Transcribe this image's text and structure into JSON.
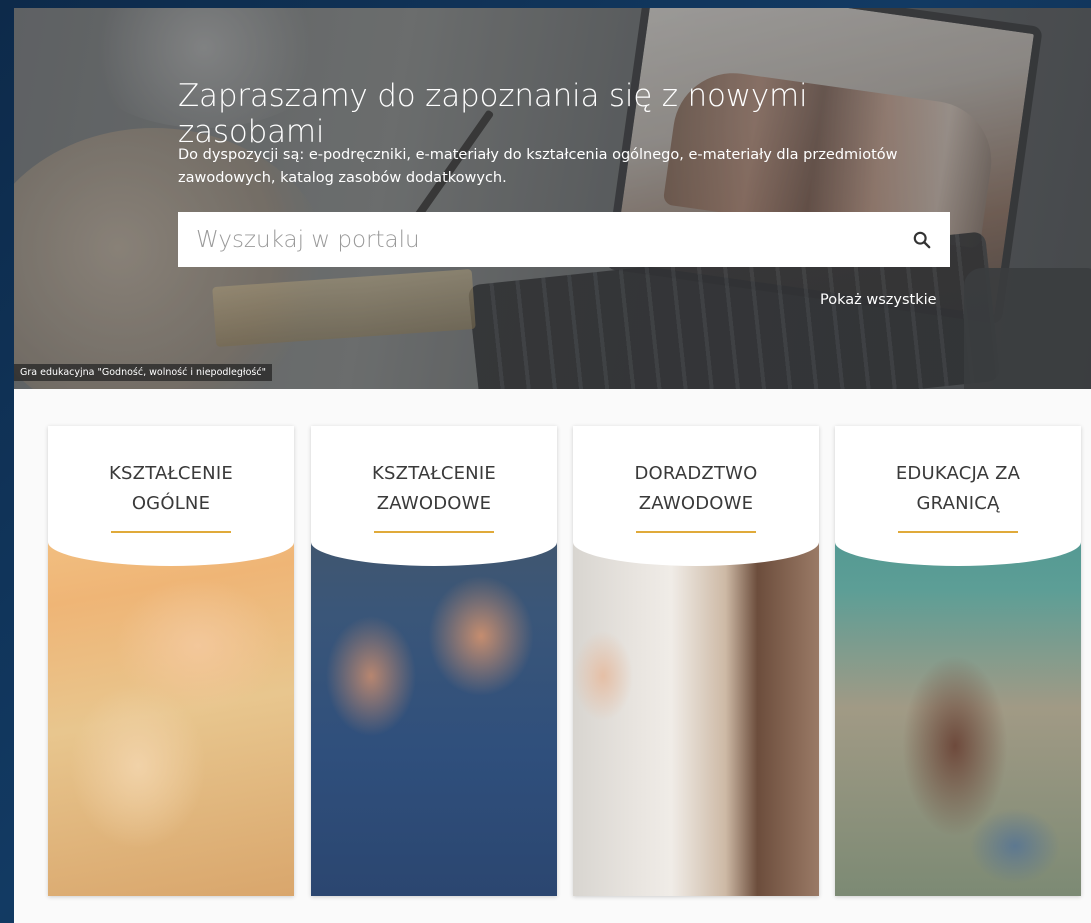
{
  "hero": {
    "title": "Zapraszamy do zapoznania się z nowymi zasobami",
    "subtitle": "Do dyspozycji są: e-podręczniki, e-materiały do kształcenia ogólnego, e-materiały dla przedmiotów zawodowych, katalog zasobów dodatkowych.",
    "search": {
      "placeholder": "Wyszukaj w portalu",
      "value": "",
      "icon": "search-icon"
    },
    "show_all": "Pokaż wszystkie",
    "image_caption": "Gra edukacyjna \"Godność, wolność i niepodległość\""
  },
  "cards": [
    {
      "label": "KSZTAŁCENIE OGÓLNE"
    },
    {
      "label": "KSZTAŁCENIE ZAWODOWE"
    },
    {
      "label": "DORADZTWO ZAWODOWE"
    },
    {
      "label": "EDUKACJA ZA GRANICĄ"
    }
  ],
  "colors": {
    "accent": "#e0aa3a",
    "frame": "#0f2540",
    "card_title": "#3a3a3a"
  }
}
